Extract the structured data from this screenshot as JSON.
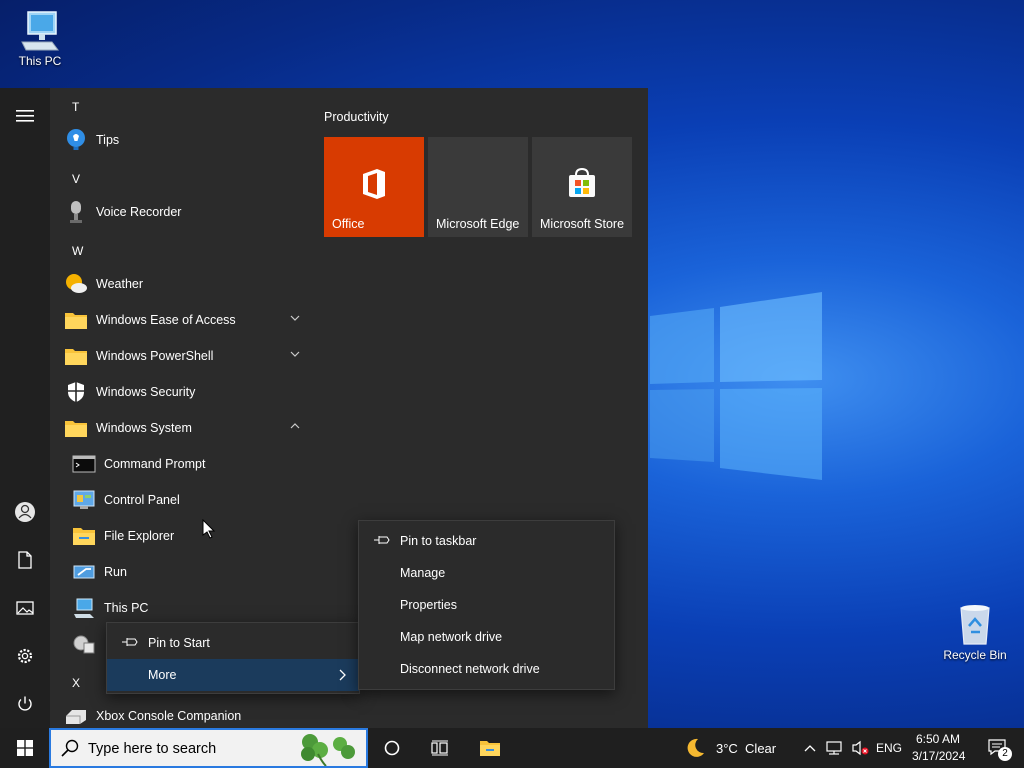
{
  "desktop": {
    "icons": [
      {
        "label": "This PC"
      },
      {
        "label": "Recycle Bin"
      }
    ]
  },
  "start_menu": {
    "app_list": [
      {
        "kind": "letter",
        "text": "T"
      },
      {
        "kind": "app",
        "label": "Tips",
        "icon": "lightbulb-icon"
      },
      {
        "kind": "letter",
        "text": "V"
      },
      {
        "kind": "app",
        "label": "Voice Recorder",
        "icon": "microphone-icon"
      },
      {
        "kind": "letter",
        "text": "W"
      },
      {
        "kind": "app",
        "label": "Weather",
        "icon": "weather-icon"
      },
      {
        "kind": "folder",
        "label": "Windows Ease of Access",
        "expanded": false
      },
      {
        "kind": "folder",
        "label": "Windows PowerShell",
        "expanded": false
      },
      {
        "kind": "app",
        "label": "Windows Security",
        "icon": "shield-icon"
      },
      {
        "kind": "folder",
        "label": "Windows System",
        "expanded": true
      },
      {
        "kind": "sub",
        "label": "Command Prompt",
        "icon": "terminal-icon"
      },
      {
        "kind": "sub",
        "label": "Control Panel",
        "icon": "control-panel-icon"
      },
      {
        "kind": "sub",
        "label": "File Explorer",
        "icon": "folder-icon"
      },
      {
        "kind": "sub",
        "label": "Run",
        "icon": "run-icon"
      },
      {
        "kind": "sub",
        "label": "This PC",
        "icon": "computer-icon"
      },
      {
        "kind": "letter",
        "text": "X"
      },
      {
        "kind": "app",
        "label": "Xbox Console Companion",
        "icon": "xbox-icon"
      }
    ],
    "tiles_group_title": "Productivity",
    "tiles": [
      {
        "label": "Office",
        "icon": "office-icon",
        "color": "#d83b01"
      },
      {
        "label": "Microsoft Edge",
        "icon": "edge-icon",
        "color": "#3a3a3a"
      },
      {
        "label": "Microsoft Store",
        "icon": "store-icon",
        "color": "#3a3a3a"
      }
    ]
  },
  "context_menu_primary": {
    "items": [
      {
        "label": "Pin to Start",
        "icon": "pin-icon"
      },
      {
        "label": "More",
        "icon": "chevron-right-icon",
        "highlighted": true
      }
    ]
  },
  "context_menu_more": {
    "items": [
      {
        "label": "Pin to taskbar",
        "icon": "pin-icon"
      },
      {
        "label": "Manage"
      },
      {
        "label": "Properties"
      },
      {
        "label": "Map network drive"
      },
      {
        "label": "Disconnect network drive"
      }
    ]
  },
  "taskbar": {
    "search_placeholder": "Type here to search",
    "weather": "3°C  Clear",
    "language": "ENG",
    "time": "6:50 AM",
    "date": "3/17/2024",
    "notification_count": "2"
  },
  "colors": {
    "accent": "#0078d7",
    "office_tile": "#d83b01",
    "menu_bg": "#2b2b2b",
    "rail_bg": "#202020",
    "taskbar_bg": "#1f1f1f",
    "context_highlight": "#1b3b5c"
  }
}
